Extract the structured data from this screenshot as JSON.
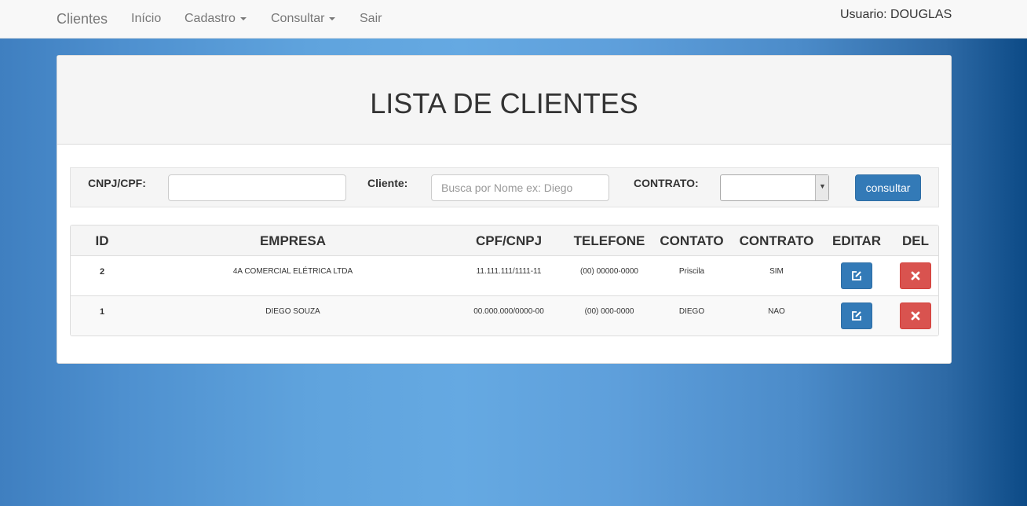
{
  "navbar": {
    "brand": "Clientes",
    "items": [
      "Início",
      "Cadastro",
      "Consultar",
      "Sair"
    ],
    "user": "Usuario: DOUGLAS"
  },
  "page": {
    "title": "LISTA DE CLIENTES"
  },
  "filter": {
    "cnpj_label": "CNPJ/CPF:",
    "cnpj_value": "",
    "cliente_label": "Cliente:",
    "cliente_placeholder": "Busca por Nome ex: Diego",
    "contrato_label": "CONTRATO:",
    "contrato_value": "",
    "button": "consultar"
  },
  "table": {
    "headers": [
      "ID",
      "EMPRESA",
      "CPF/CNPJ",
      "TELEFONE",
      "CONTATO",
      "CONTRATO",
      "EDITAR",
      "DEL"
    ],
    "rows": [
      {
        "id": "2",
        "empresa": "4A COMERCIAL ELÉTRICA LTDA",
        "cpf": "11.111.111/1111-11",
        "telefone": "(00) 00000-0000",
        "contato": "Priscila",
        "contrato": "SIM"
      },
      {
        "id": "1",
        "empresa": "DIEGO SOUZA",
        "cpf": "00.000.000/0000-00",
        "telefone": "(00) 000-0000",
        "contato": "DIEGO",
        "contrato": "NAO"
      }
    ]
  },
  "icons": {
    "edit": "edit-icon",
    "delete": "close-icon",
    "dropdown": "chevron-down-icon"
  },
  "colors": {
    "primary": "#337ab7",
    "danger": "#d9534f"
  }
}
